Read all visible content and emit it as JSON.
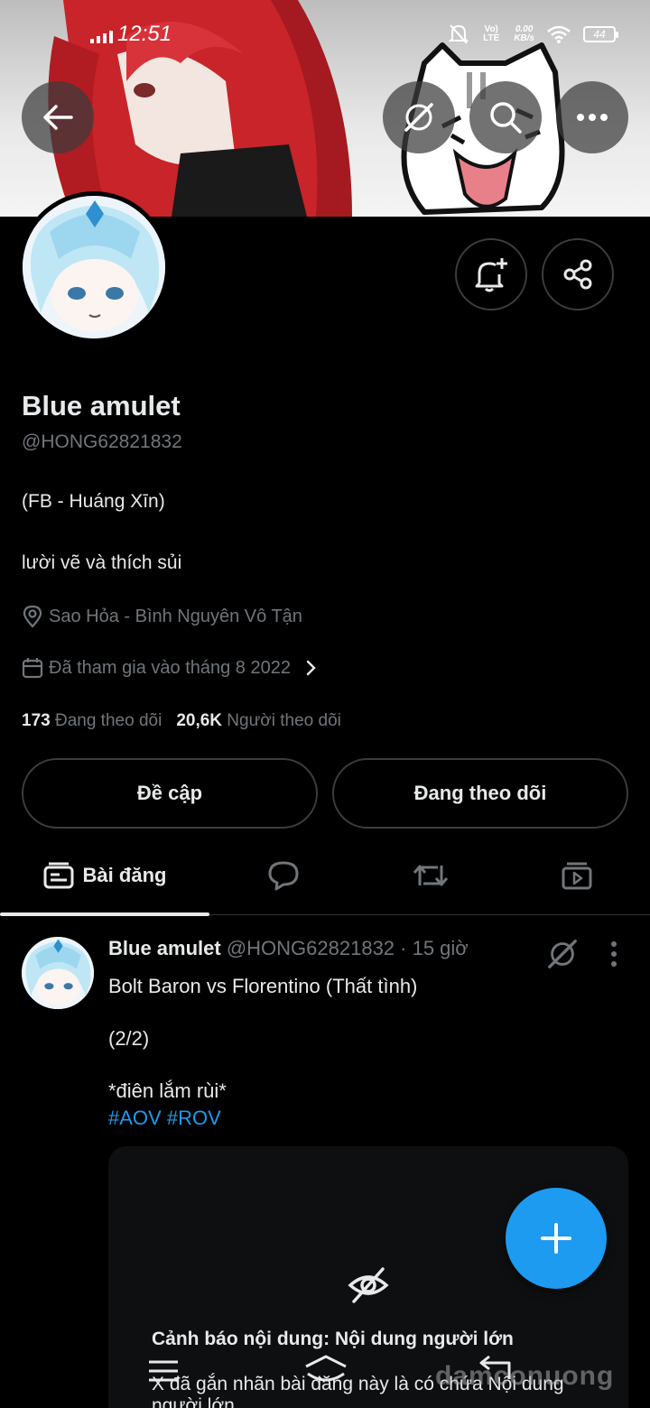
{
  "status_bar": {
    "time": "12:51",
    "network_label": "Vo) LTE",
    "speed_value": "0.00",
    "speed_unit": "KB/s",
    "battery": "44"
  },
  "header": {
    "back_icon": "arrow-left-icon",
    "grok_icon": "grok-icon",
    "search_icon": "search-icon",
    "more_icon": "more-horizontal-icon"
  },
  "profile": {
    "name": "Blue amulet",
    "handle": "@HONG62821832",
    "bio_line1": "(FB - Huáng Xīn)",
    "bio_line2": "lười vẽ và thích sủi",
    "location": "Sao Hỏa - Bình Nguyên Vô Tận",
    "joined": "Đã tham gia vào tháng 8 2022",
    "following_count": "173",
    "following_label": "Đang theo dõi",
    "followers_count": "20,6K",
    "followers_label": "Người theo dõi"
  },
  "actions": {
    "mention_label": "Đề cập",
    "following_button_label": "Đang theo dõi"
  },
  "tabs": {
    "posts_label": "Bài đăng",
    "active": "posts"
  },
  "post": {
    "author": "Blue amulet",
    "handle_time": "@HONG62821832 · 15 giờ",
    "line1": "Bolt Baron vs Florentino (Thất tình)",
    "line2": "(2/2)",
    "line3": "*điên lắm rùi*",
    "hashtag1": "#AOV",
    "hashtag2": "#ROV",
    "warning_title": "Cảnh báo nội dung: Nội dung người lớn",
    "warning_text": "X đã gắn nhãn bài đăng này là có chứa Nội dung người lớn."
  },
  "watermark": "damconuong",
  "colors": {
    "background": "#000000",
    "accent": "#1d9bf0",
    "secondary_text": "#71767b",
    "border": "#2f3336"
  }
}
